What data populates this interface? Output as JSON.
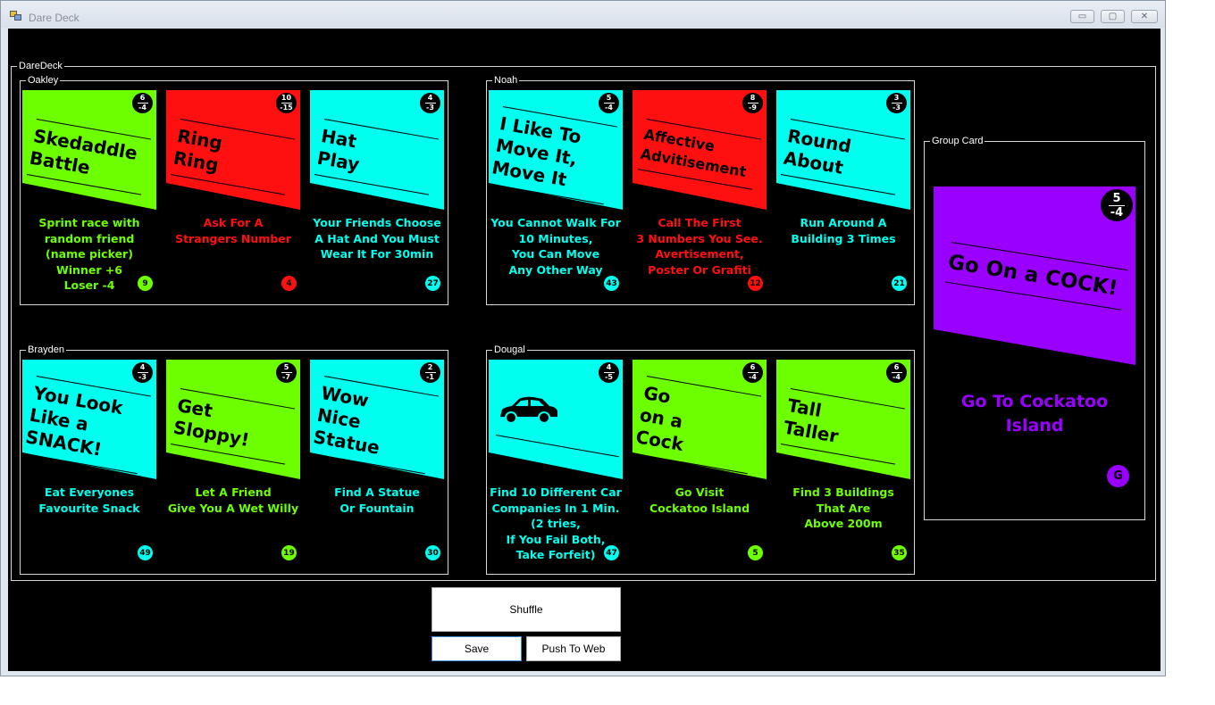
{
  "window": {
    "title": "Dare Deck",
    "minimize": "▭",
    "maximize": "▢",
    "close": "✕"
  },
  "colors": {
    "green": "#6dff00",
    "red": "#ff1010",
    "cyan": "#00ffee",
    "purple": "#9900ff"
  },
  "deck_label": "DareDeck",
  "players": [
    {
      "name": "Oakley",
      "cards": [
        {
          "title": "Skedaddle\nBattle",
          "top": "6",
          "bottom": "-4",
          "color": "green",
          "desc": "Sprint race with\nrandom friend\n(name picker)\nWinner +6\nLoser -4",
          "number": "9"
        },
        {
          "title": "Ring\nRing",
          "top": "10",
          "bottom": "-15",
          "color": "red",
          "desc": "Ask For A\nStrangers Number",
          "number": "4"
        },
        {
          "title": "Hat\nPlay",
          "top": "4",
          "bottom": "-3",
          "color": "cyan",
          "desc": "Your Friends Choose\nA Hat And You Must\nWear It For 30min",
          "number": "27"
        }
      ]
    },
    {
      "name": "Noah",
      "cards": [
        {
          "title": "I Like To\nMove It,\nMove It",
          "top": "5",
          "bottom": "-4",
          "color": "cyan",
          "desc": "You Cannot Walk For\n10 Minutes,\nYou Can Move\nAny Other Way",
          "number": "43"
        },
        {
          "title": "Affective\nAdvitisement",
          "top": "8",
          "bottom": "-9",
          "color": "red",
          "desc": "Call The First\n3 Numbers You See.\nAvertisement,\nPoster Or Grafiti",
          "number": "12"
        },
        {
          "title": "Round\nAbout",
          "top": "3",
          "bottom": "-3",
          "color": "cyan",
          "desc": "Run Around A\nBuilding 3 Times",
          "number": "21"
        }
      ]
    },
    {
      "name": "Brayden",
      "cards": [
        {
          "title": "You Look\nLike a\nSNACK!",
          "top": "4",
          "bottom": "-3",
          "color": "cyan",
          "desc": "Eat Everyones\nFavourite Snack",
          "number": "49"
        },
        {
          "title": "Get\nSloppy!",
          "top": "5",
          "bottom": "-7",
          "color": "green",
          "desc": "Let A Friend\nGive You A Wet Willy",
          "number": "19"
        },
        {
          "title": "Wow\nNice\nStatue",
          "top": "2",
          "bottom": "-1",
          "color": "cyan",
          "desc": "Find A Statue\nOr Fountain",
          "number": "30"
        }
      ]
    },
    {
      "name": "Dougal",
      "cards": [
        {
          "title": "",
          "icon": "car-icon",
          "top": "4",
          "bottom": "-5",
          "color": "cyan",
          "desc": "Find 10 Different Car\nCompanies In 1 Min.\n(2 tries,\nIf You Fail Both,\nTake Forfeit)",
          "number": "47"
        },
        {
          "title": "Go\non a\nCock",
          "top": "6",
          "bottom": "-4",
          "color": "green",
          "desc": "Go Visit\nCockatoo Island",
          "number": "5"
        },
        {
          "title": "Tall\nTaller",
          "top": "6",
          "bottom": "-4",
          "color": "green",
          "desc": "Find 3 Buildings\nThat Are\nAbove 200m",
          "number": "35"
        }
      ]
    }
  ],
  "group_card": {
    "label": "Group Card",
    "title": "Go On a COCK!",
    "top": "5",
    "bottom": "-4",
    "color": "purple",
    "desc": "Go To Cockatoo\nIsland",
    "number": "G"
  },
  "buttons": {
    "shuffle": "Shuffle",
    "save": "Save",
    "push": "Push To Web"
  }
}
